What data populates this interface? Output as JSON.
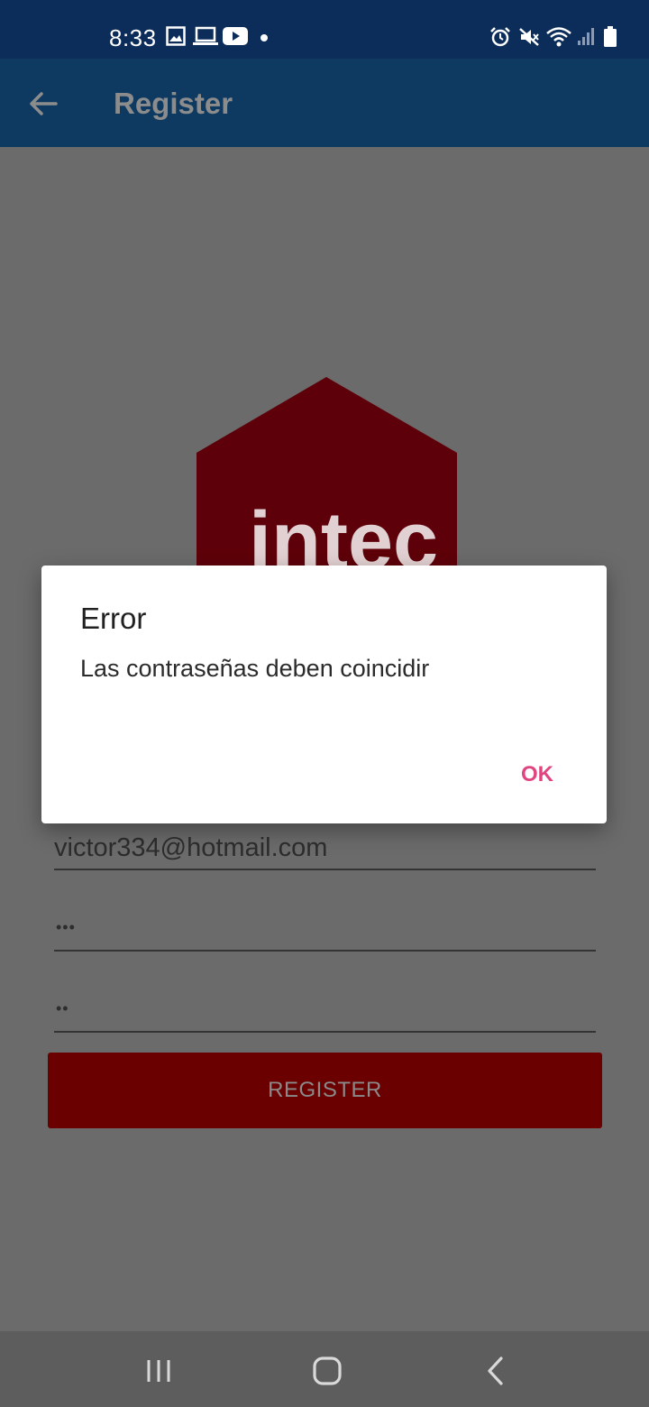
{
  "status_bar": {
    "time": "8:33"
  },
  "app_bar": {
    "title": "Register"
  },
  "logo": {
    "text": "intec",
    "color": "#5e0009"
  },
  "form": {
    "email_value": "victor334@hotmail.com",
    "password_dots": "•••",
    "confirm_dots": "••",
    "register_label": "REGISTER"
  },
  "dialog": {
    "title": "Error",
    "message": "Las contraseñas deben coincidir",
    "ok_label": "OK"
  },
  "icons": {
    "status_left": [
      "image-icon",
      "laptop-icon",
      "youtube-icon",
      "notification-dot-icon"
    ],
    "status_right": [
      "alarm-icon",
      "mute-icon",
      "wifi-icon",
      "signal-icon",
      "battery-icon"
    ],
    "nav": [
      "recent-apps-icon",
      "home-icon",
      "back-icon"
    ]
  },
  "colors": {
    "status_bar": "#0c2d59",
    "app_bar": "#0e3a62",
    "accent": "#e0457f",
    "register_button": "#6b0000",
    "scrim": "#6b6b6b"
  }
}
